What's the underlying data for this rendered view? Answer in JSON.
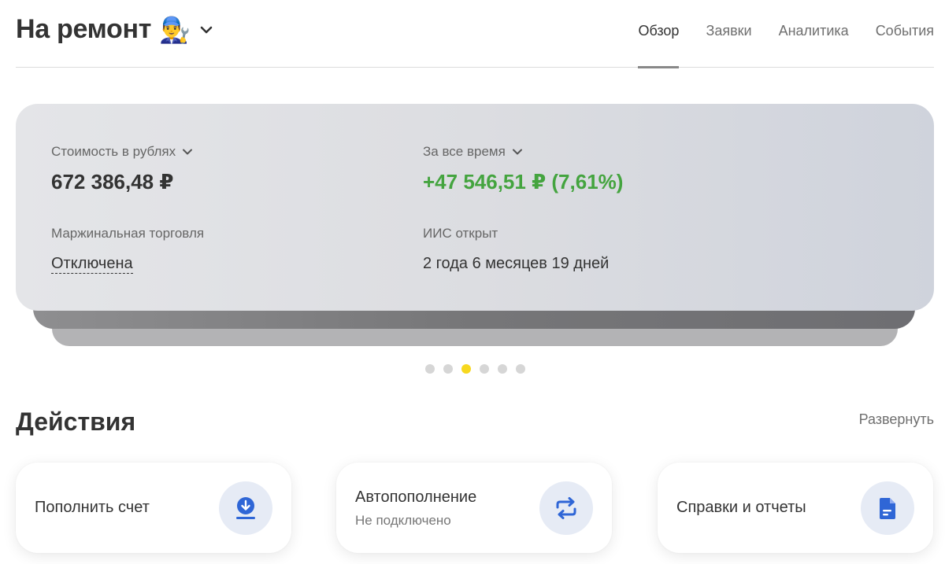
{
  "header": {
    "account_name": "На ремонт",
    "account_emoji": "👨‍🔧",
    "tabs": [
      {
        "label": "Обзор",
        "active": true
      },
      {
        "label": "Заявки",
        "active": false
      },
      {
        "label": "Аналитика",
        "active": false
      },
      {
        "label": "События",
        "active": false
      }
    ]
  },
  "overview_card": {
    "value_label": "Стоимость в рублях",
    "value_amount": "672 386,48 ₽",
    "period_label": "За все время",
    "profit": "+47 546,51 ₽ (7,61%)",
    "margin_label": "Маржинальная торговля",
    "margin_status": "Отключена",
    "iis_label": "ИИС открыт",
    "iis_duration": "2 года 6 месяцев 19 дней"
  },
  "carousel": {
    "total": 6,
    "active_index": 2
  },
  "actions": {
    "title": "Действия",
    "expand_label": "Развернуть",
    "items": [
      {
        "title": "Пополнить счет",
        "subtitle": "",
        "icon": "download-icon"
      },
      {
        "title": "Автопополнение",
        "subtitle": "Не подключено",
        "icon": "repeat-icon"
      },
      {
        "title": "Справки и отчеты",
        "subtitle": "",
        "icon": "document-icon"
      }
    ]
  },
  "colors": {
    "profit_green": "#44a43f",
    "dot_active": "#f7d81f",
    "icon_blue": "#2f66d6",
    "icon_bg": "#e6ebf5"
  }
}
